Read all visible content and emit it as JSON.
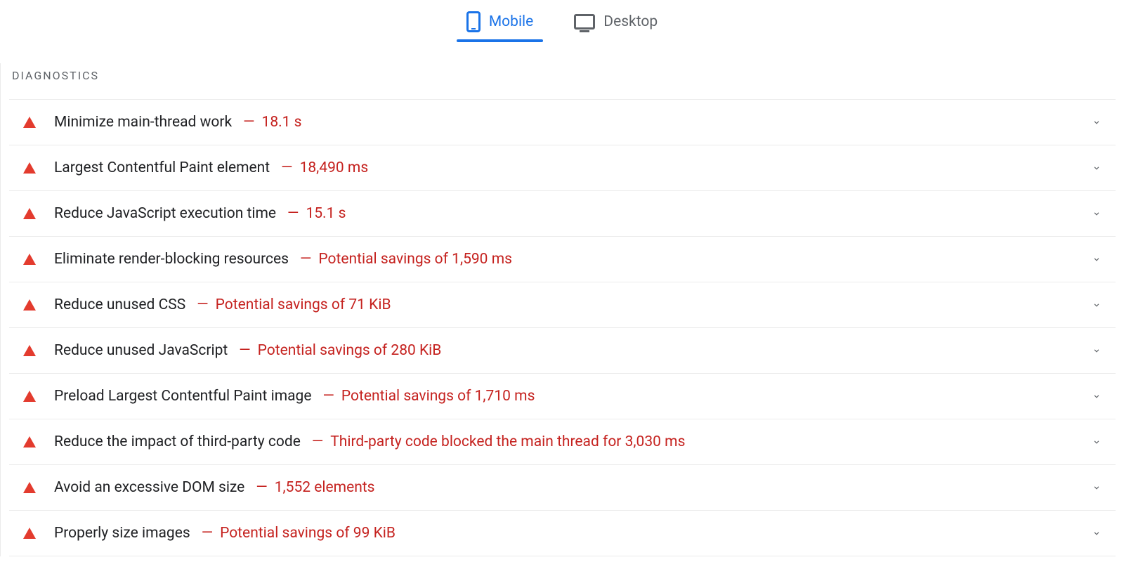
{
  "tabs": {
    "mobile": "Mobile",
    "desktop": "Desktop"
  },
  "section_title": "DIAGNOSTICS",
  "separator": "—",
  "diagnostics": [
    {
      "title": "Minimize main-thread work",
      "detail": "18.1 s"
    },
    {
      "title": "Largest Contentful Paint element",
      "detail": "18,490 ms"
    },
    {
      "title": "Reduce JavaScript execution time",
      "detail": "15.1 s"
    },
    {
      "title": "Eliminate render-blocking resources",
      "detail": "Potential savings of 1,590 ms"
    },
    {
      "title": "Reduce unused CSS",
      "detail": "Potential savings of 71 KiB"
    },
    {
      "title": "Reduce unused JavaScript",
      "detail": "Potential savings of 280 KiB"
    },
    {
      "title": "Preload Largest Contentful Paint image",
      "detail": "Potential savings of 1,710 ms"
    },
    {
      "title": "Reduce the impact of third-party code",
      "detail": "Third-party code blocked the main thread for 3,030 ms"
    },
    {
      "title": "Avoid an excessive DOM size",
      "detail": "1,552 elements"
    },
    {
      "title": "Properly size images",
      "detail": "Potential savings of 99 KiB"
    }
  ]
}
